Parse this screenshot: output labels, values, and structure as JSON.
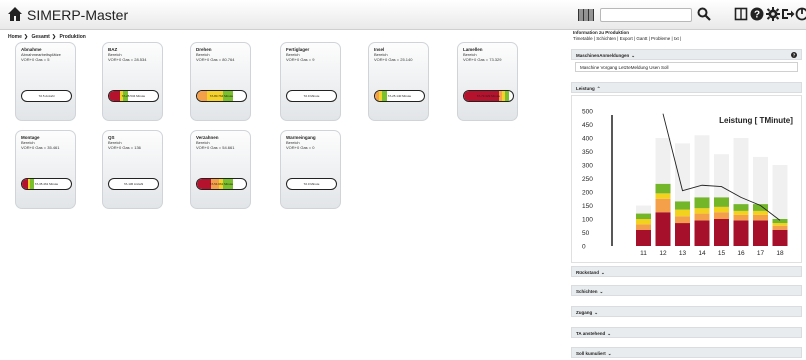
{
  "app": {
    "title": "SIMERP-Master",
    "search_value": ""
  },
  "breadcrumb": [
    "Home",
    "Gesamt",
    "Produktion"
  ],
  "cards": [
    {
      "name": "Abnahme",
      "line2": "Abnahmearbeitsplätze",
      "line3": "VOR+0 Gas = 5",
      "label": "TA 5 Anzahl",
      "segments": []
    },
    {
      "name": "BAZ",
      "line2": "Bereich",
      "line3": "VOR+0 Gas = 28.534",
      "label": "TA 28.534 Minute",
      "segments": [
        [
          "#b5122d",
          0.22
        ],
        [
          "#f5d12a",
          0.08
        ],
        [
          "#7ac02c",
          0.1
        ]
      ]
    },
    {
      "name": "Drehen",
      "line2": "Bereich",
      "line3": "VOR+0 Gas = 80.764",
      "label": "TA 80.764 Minute",
      "segments": [
        [
          "#f4a04a",
          0.2
        ],
        [
          "#f5d12a",
          0.35
        ],
        [
          "#7ac02c",
          0.2
        ]
      ]
    },
    {
      "name": "Fertiglager",
      "line2": "Bereich",
      "line3": "VOR+0 Gas = 9",
      "label": "TA 9 Minute",
      "segments": []
    },
    {
      "name": "Insel",
      "line2": "Bereich",
      "line3": "VOR+0 Gas = 25.140",
      "label": "TA 25.140 Minute",
      "segments": [
        [
          "#f4a04a",
          0.08
        ],
        [
          "#f5d12a",
          0.06
        ],
        [
          "#7ac02c",
          0.1
        ]
      ]
    },
    {
      "name": "Lamellen",
      "line2": "Bereich",
      "line3": "VOR+0 Gas = 73.329",
      "label": "TA 73.329 Minute",
      "segments": [
        [
          "#b5122d",
          0.72
        ],
        [
          "#f4a04a",
          0.08
        ],
        [
          "#f5d12a",
          0.06
        ],
        [
          "#7ac02c",
          0.08
        ]
      ]
    },
    {
      "name": "Montage",
      "line2": "Bereich",
      "line3": "VOR+0 Gas = 35.461",
      "label": "TA 35.461 Minute",
      "segments": [
        [
          "#b5122d",
          0.12
        ],
        [
          "#f5d12a",
          0.04
        ],
        [
          "#7ac02c",
          0.1
        ]
      ]
    },
    {
      "name": "QS",
      "line2": "Bereich",
      "line3": "VOR+0 Gas = 136",
      "label": "TA 136 Anzahl",
      "segments": []
    },
    {
      "name": "Verzahnen",
      "line2": "Bereich",
      "line3": "VOR+0 Gas = 54.661",
      "label": "TA 54.661 Minute",
      "segments": [
        [
          "#b5122d",
          0.3
        ],
        [
          "#f4a04a",
          0.15
        ],
        [
          "#f5d12a",
          0.1
        ],
        [
          "#7ac02c",
          0.2
        ]
      ]
    },
    {
      "name": "Warmeingang",
      "line2": "Bereich",
      "line3": "VOR+0 Gas = 0",
      "label": "TA 0 Minute",
      "segments": []
    }
  ],
  "right_panel": {
    "title": "Information zu Produktion",
    "links": "Timetable | Schichten | Export | Gantt | Probleme | txt |",
    "sections": {
      "maschinen": "MaschinenAnmeldungen",
      "maschinen_cols": "Maschine  Vorgang  LetzteMeldung  Usen  Soll",
      "leistung": "Leistung",
      "rueckstand": "Rückstand",
      "schichten": "Schichten",
      "zugang": "Zugang",
      "ta_anstehend": "TA anstehend",
      "soll_kumuliert": "Soll kumuliert"
    }
  },
  "chart_data": {
    "type": "bar",
    "title": "Leistung [ TMinute]",
    "categories": [
      "11",
      "12",
      "13",
      "14",
      "15",
      "16",
      "17",
      "18"
    ],
    "ylim": [
      0,
      500
    ],
    "yticks": [
      0,
      50,
      100,
      150,
      200,
      250,
      300,
      350,
      400,
      450,
      500
    ],
    "background_max": [
      150,
      400,
      380,
      410,
      340,
      400,
      330,
      300
    ],
    "series": [
      {
        "name": "red",
        "color": "#a7102a",
        "values": [
          60,
          125,
          85,
          95,
          100,
          95,
          95,
          60
        ]
      },
      {
        "name": "orange",
        "color": "#f4a04a",
        "values": [
          20,
          50,
          25,
          25,
          25,
          20,
          20,
          15
        ]
      },
      {
        "name": "yellow",
        "color": "#f3d21f",
        "values": [
          20,
          20,
          25,
          20,
          20,
          15,
          15,
          10
        ]
      },
      {
        "name": "green",
        "color": "#74b62a",
        "values": [
          20,
          35,
          30,
          40,
          35,
          25,
          25,
          15
        ]
      }
    ],
    "line": [
      null,
      490,
      205,
      225,
      220,
      180,
      150,
      95
    ],
    "grid": false,
    "legend": "none"
  }
}
